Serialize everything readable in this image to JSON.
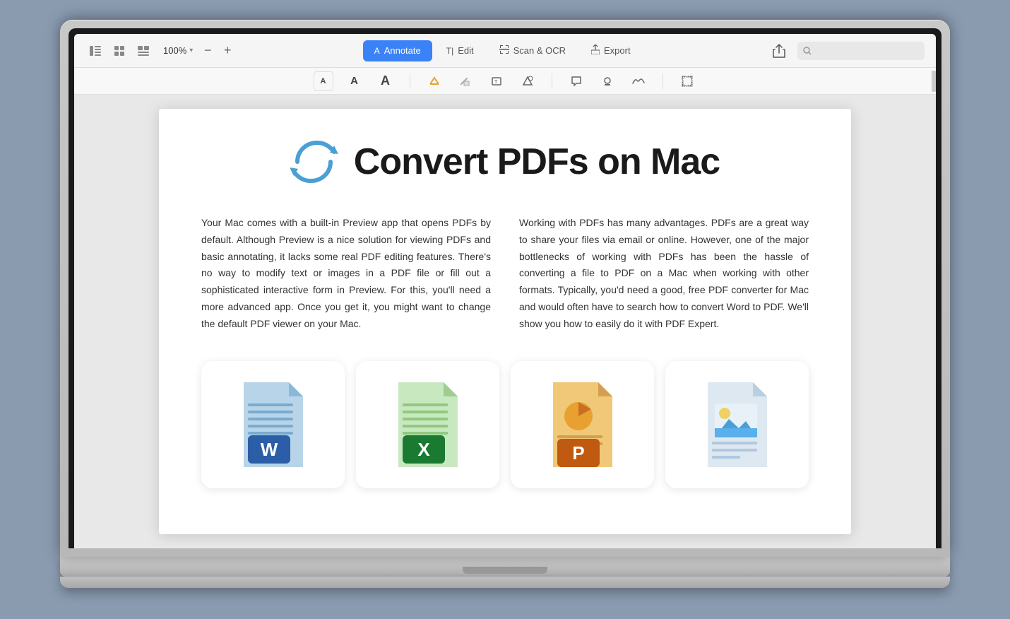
{
  "toolbar": {
    "zoom": "100%",
    "zoom_minus": "−",
    "zoom_plus": "+",
    "tabs": [
      {
        "id": "annotate",
        "label": "Annotate",
        "active": true
      },
      {
        "id": "edit",
        "label": "Edit",
        "active": false
      },
      {
        "id": "scan_ocr",
        "label": "Scan & OCR",
        "active": false
      },
      {
        "id": "export",
        "label": "Export",
        "active": false
      }
    ],
    "search_placeholder": "Search"
  },
  "annotation_tools": [
    "A",
    "A",
    "A",
    "✏",
    "◇",
    "T",
    "☆",
    "💬",
    "👤",
    "✍",
    "⬚"
  ],
  "page": {
    "title": "Convert PDFs on Mac",
    "col1": "Your Mac comes with a built-in Preview app that opens PDFs by default. Although Preview is a nice solution for viewing PDFs and basic annotating, it lacks some real PDF editing features. There's no way to modify text or images in a PDF file or fill out a sophisticated interactive form in Preview. For this, you'll need a more advanced app. Once you get it, you might want to change the default PDF viewer on your Mac.",
    "col2": "Working with PDFs has many advantages. PDFs are a great way to share your files via email or online. However, one of the major bottlenecks of working with PDFs has been the hassle of converting a file to PDF on a Mac when working with other formats. Typically, you'd need a good, free PDF converter for Mac and would often have to search how to convert Word to PDF. We'll show you how to easily do it with PDF Expert."
  },
  "app_icons": [
    {
      "type": "word",
      "color": "#4a9fd4",
      "letter": "W",
      "letter_color": "#2b5ea7"
    },
    {
      "type": "excel",
      "color": "#3db454",
      "letter": "X",
      "letter_color": "#1a7a32"
    },
    {
      "type": "powerpoint",
      "color": "#e8922a",
      "letter": "P",
      "letter_color": "#c05a10"
    },
    {
      "type": "image",
      "color": "#d8e4f0",
      "letter": "🖼",
      "letter_color": "#5a9fd4"
    }
  ],
  "colors": {
    "active_tab": "#3b82f6",
    "sync_icon": "#4a9fd4"
  }
}
